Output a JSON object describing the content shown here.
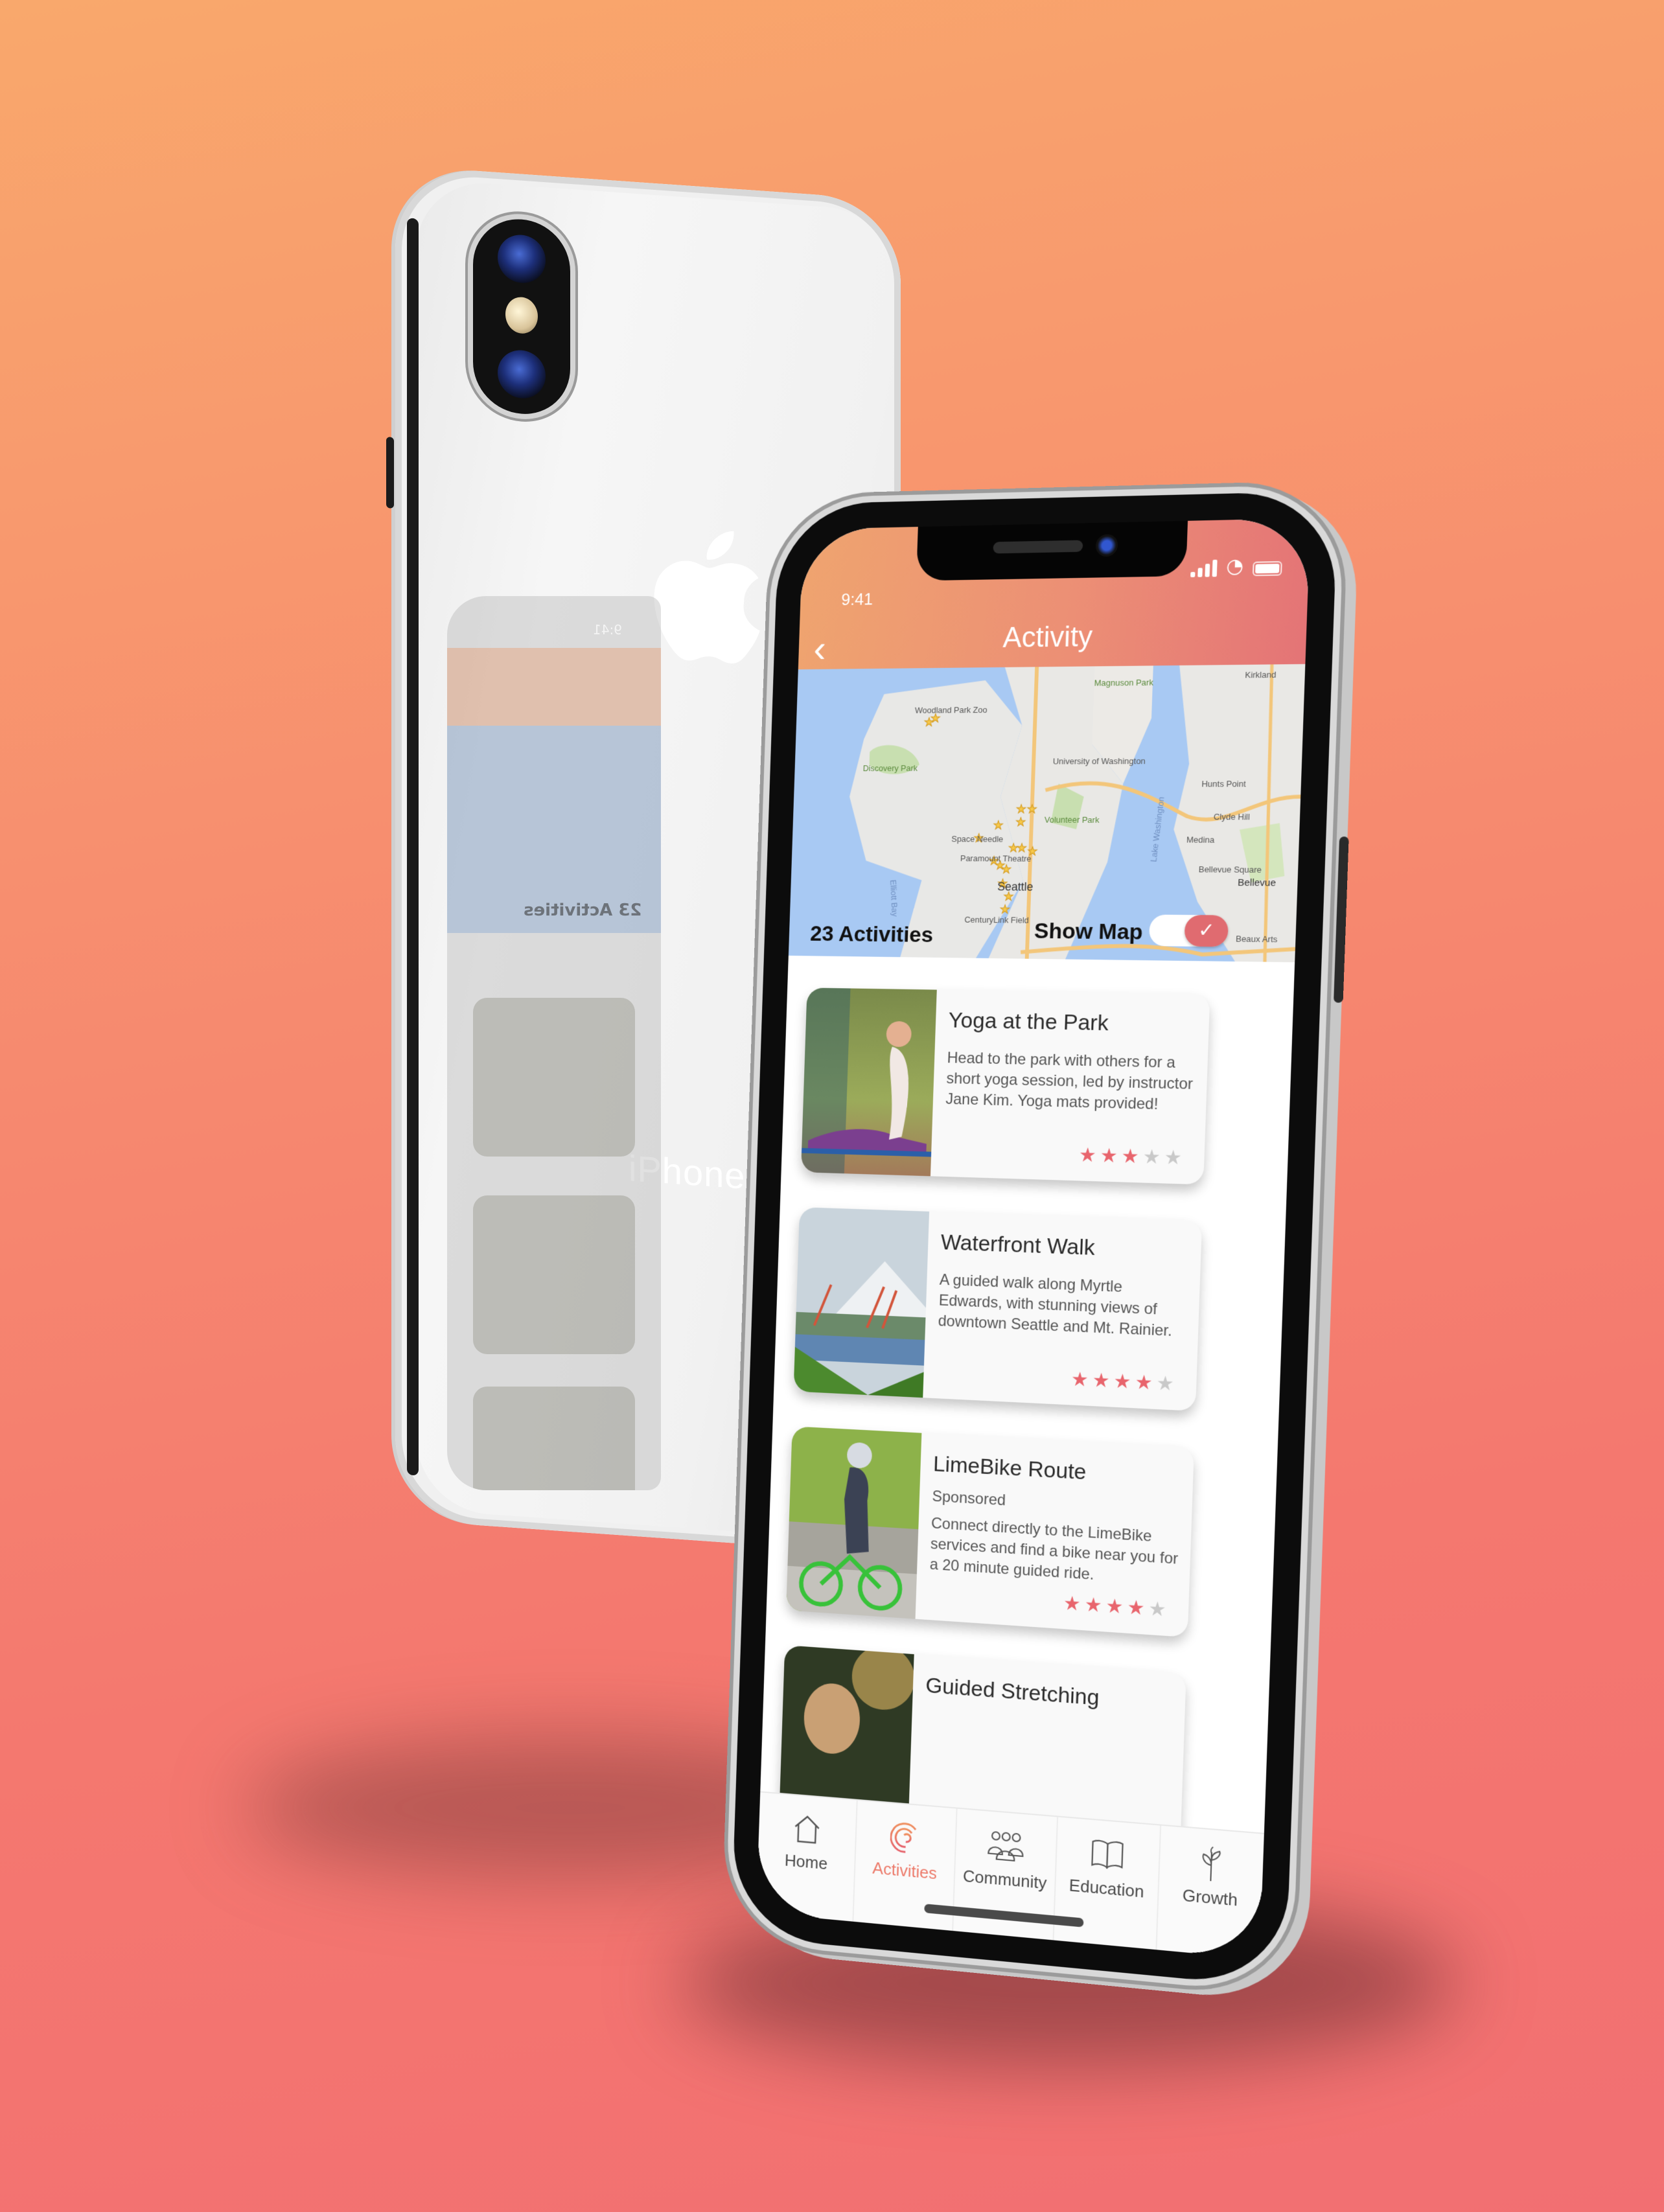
{
  "mockup": {
    "back_phone": {
      "brand_wordmark": "iPhone"
    },
    "ghost_screen": {
      "time": "9:41",
      "activity_count": "23 Activities"
    }
  },
  "status_bar": {
    "time": "9:41",
    "signal_bars": 4,
    "wifi": true,
    "battery_level": 1.0
  },
  "header": {
    "title": "Activity",
    "back_icon": "chevron-left-icon"
  },
  "map": {
    "region": "Seattle",
    "labels": [
      "Woodland Park Zoo",
      "Discovery Park",
      "University of Washington",
      "Volunteer Park",
      "Space Needle",
      "Paramount Theatre",
      "Seattle",
      "CenturyLink Field",
      "Hunts Point",
      "Clyde Hill",
      "Medina",
      "Bellevue Square",
      "Bellevue",
      "Beaux Arts",
      "Lake Washington",
      "Elliott Bay",
      "Magnuson Park",
      "Kirkland"
    ],
    "activity_count_label": "23 Activities",
    "show_map_label": "Show Map",
    "show_map_enabled": true
  },
  "activities": [
    {
      "title": "Yoga at the Park",
      "sponsored": null,
      "description": "Head to the park with others for a short yoga session, led by instructor Jane Kim. Yoga mats provided!",
      "rating": 3,
      "rating_max": 5,
      "image": "woman doing yoga in park"
    },
    {
      "title": "Waterfront Walk",
      "sponsored": null,
      "description": "A guided walk along Myrtle Edwards, with stunning views of downtown Seattle and Mt. Rainier.",
      "rating": 4,
      "rating_max": 5,
      "image": "family walking by waterfront with Mt. Rainier"
    },
    {
      "title": "LimeBike Route",
      "sponsored": "Sponsored",
      "description": "Connect directly to the LimeBike services and find a bike near you for a 20 minute guided ride.",
      "rating": 4,
      "rating_max": 5,
      "image": "woman riding green LimeBike"
    },
    {
      "title": "Guided Stretching",
      "sponsored": null,
      "description": "",
      "rating": null,
      "rating_max": 5,
      "image": "woman stretching outdoors"
    }
  ],
  "tabbar": {
    "tabs": [
      {
        "label": "Home",
        "icon": "house-icon",
        "active": false
      },
      {
        "label": "Activities",
        "icon": "activity-spiral-icon",
        "active": true
      },
      {
        "label": "Community",
        "icon": "people-icon",
        "active": false
      },
      {
        "label": "Education",
        "icon": "book-icon",
        "active": false
      },
      {
        "label": "Growth",
        "icon": "sprout-icon",
        "active": false
      }
    ]
  },
  "colors": {
    "accent": "#e8656d",
    "header_start": "#efa46f",
    "header_end": "#e47476",
    "active_tab": "#ec7a6a",
    "star_off": "#c9c9c9"
  }
}
